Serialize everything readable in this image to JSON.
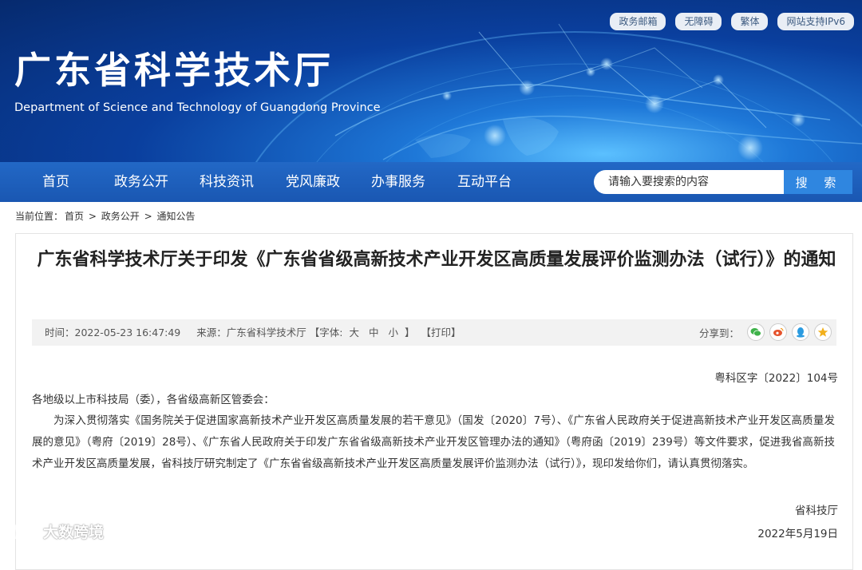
{
  "header": {
    "title": "广东省科学技术厅",
    "subtitle": "Department of Science and Technology of Guangdong Province",
    "top_links": [
      "政务邮箱",
      "无障碍",
      "繁体",
      "网站支持IPv6"
    ]
  },
  "nav": {
    "items": [
      "首页",
      "政务公开",
      "科技资讯",
      "党风廉政",
      "办事服务",
      "互动平台"
    ],
    "search_placeholder": "请输入要搜索的内容",
    "search_button": "搜 索"
  },
  "breadcrumb": {
    "prefix": "当前位置：",
    "items": [
      "首页",
      "政务公开",
      "通知公告"
    ],
    "separator": ">"
  },
  "article": {
    "title": "广东省科学技术厅关于印发《广东省省级高新技术产业开发区高质量发展评价监测办法（试行）》的通知",
    "meta": {
      "time": "时间：2022-05-23 16:47:49",
      "source": "来源：广东省科学技术厅",
      "font_label": "【字体:",
      "font_large": "大",
      "font_medium": "中",
      "font_small": "小",
      "font_close": "】",
      "print": "【打印】",
      "share_label": "分享到："
    },
    "doc_number": "粤科区字〔2022〕104号",
    "salutation": "各地级以上市科技局（委），各省级高新区管委会：",
    "paragraph": "为深入贯彻落实《国务院关于促进国家高新技术产业开发区高质量发展的若干意见》（国发〔2020〕7号）、《广东省人民政府关于促进高新技术产业开发区高质量发展的意见》（粤府〔2019〕28号）、《广东省人民政府关于印发广东省省级高新技术产业开发区管理办法的通知》（粤府函〔2019〕239号）等文件要求，促进我省高新技术产业开发区高质量发展，省科技厅研究制定了《广东省省级高新技术产业开发区高质量发展评价监测办法（试行）》，现印发给你们，请认真贯彻落实。",
    "signature": "省科技厅",
    "date": "2022年5月19日"
  },
  "watermark": {
    "text": "大数跨境"
  },
  "colors": {
    "nav_bg": "#1d5fbd",
    "search_button": "#2f86e0",
    "wechat": "#3fb24a",
    "weibo": "#e5532d",
    "qq": "#2b9be0",
    "qzone": "#f2b01c"
  }
}
